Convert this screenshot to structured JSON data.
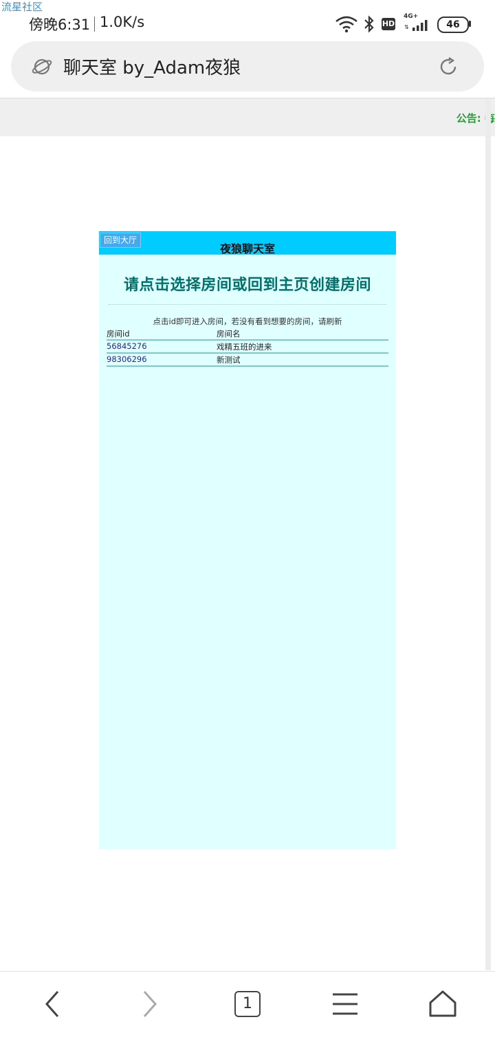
{
  "watermark": "流星社区",
  "status_bar": {
    "time": "傍晚6:31",
    "speed": "1.0K/s",
    "network": "4G+",
    "hd_badge": "HD",
    "battery": "46",
    "icons": [
      "wifi-icon",
      "bluetooth-icon",
      "hd-icon",
      "signal-icon",
      "battery-icon"
    ]
  },
  "browser": {
    "page_title": "聊天室 by_Adam夜狼",
    "icons": [
      "planet-icon",
      "refresh-icon"
    ]
  },
  "notice": "公告: 每",
  "chat": {
    "lobby_button": "回到大厅",
    "title": "夜狼聊天室",
    "heading": "请点击选择房间或回到主页创建房间",
    "hint": "点击id即可进入房间，若没有看到想要的房间，请刷新",
    "table": {
      "headers": [
        "房间id",
        "房间名"
      ],
      "rows": [
        {
          "id": "56845276",
          "name": "戏精五班的进来"
        },
        {
          "id": "98306296",
          "name": "新测试"
        }
      ]
    }
  },
  "bottom_nav": {
    "tab_count": "1",
    "icons": [
      "back-icon",
      "forward-icon",
      "tabs-icon",
      "menu-icon",
      "home-icon"
    ]
  },
  "colors": {
    "panel_bg": "#e0ffff",
    "header_bg": "#00ccff",
    "heading": "#00706b",
    "notice": "#2a9a3a"
  }
}
